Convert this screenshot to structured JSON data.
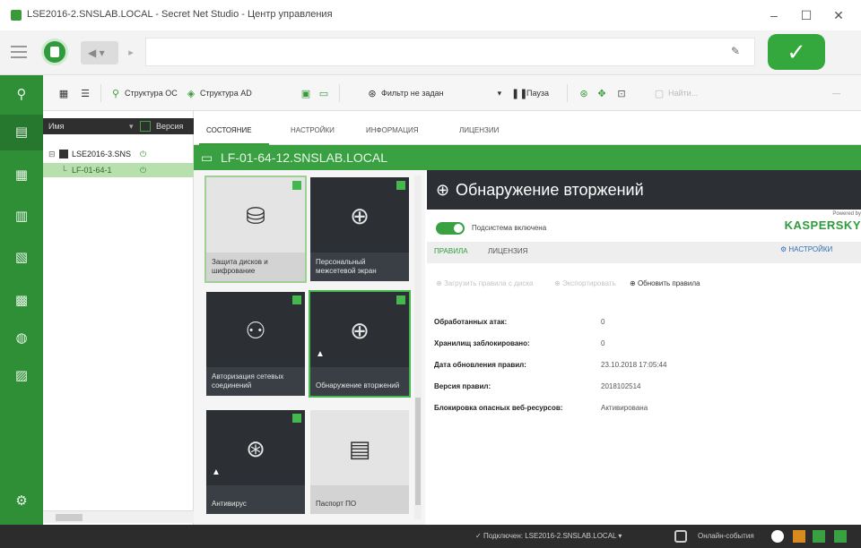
{
  "window": {
    "title": "LSE2016-2.SNSLAB.LOCAL - Secret Net Studio - Центр управления",
    "minimize_glyph": "–",
    "maximize_glyph": "☐",
    "close_glyph": "✕"
  },
  "navbar": {
    "back_glyph": "◀ ▾",
    "forward_glyph": "▸",
    "address_value": "",
    "pin_glyph": "✎",
    "ok_glyph": "✓"
  },
  "rail": {
    "icons": [
      "search-icon",
      "monitor-icon",
      "report-icon",
      "journal-icon",
      "policy-icon",
      "grid-icon",
      "shield-icon",
      "document-icon",
      "settings-icon"
    ],
    "glyphs": [
      "⚲",
      "▤",
      "▦",
      "▥",
      "▧",
      "▩",
      "◍",
      "▨",
      "⚙"
    ]
  },
  "toolbar": {
    "structure_ds": "Структура ОС",
    "structure_ad": "Структура AD",
    "filter": "Фильтр не задан",
    "pause": "Пауза",
    "search_placeholder": "Найти...",
    "view_grid_glyph": "▦",
    "view_list_glyph": "☰",
    "filter_drop": "▾"
  },
  "tree": {
    "header_name": "Имя",
    "header_status": "Версия",
    "rows": [
      "LSE2016-3.SNS",
      "LF-01-64-1"
    ]
  },
  "tabs": [
    "СОСТОЯНИЕ",
    "НАСТРОЙКИ",
    "ИНФОРМАЦИЯ",
    "ЛИЦЕНЗИИ"
  ],
  "device": {
    "name": "LF-01-64-12.SNSLAB.LOCAL"
  },
  "tiles": [
    {
      "label": "Защита дисков и шифрование",
      "style": "light",
      "glyph": "⛁",
      "warning": false,
      "corner": true
    },
    {
      "label": "Персональный межсетевой экран",
      "style": "dark",
      "glyph": "⊕",
      "warning": false,
      "corner": true
    },
    {
      "label": "Авторизация сетевых соединений",
      "style": "dark",
      "glyph": "⚇",
      "warning": false,
      "corner": true
    },
    {
      "label": "Обнаружение вторжений",
      "style": "dark",
      "glyph": "⊕",
      "warning": true,
      "corner": true
    },
    {
      "label": "Антивирус",
      "style": "dark",
      "glyph": "⊛",
      "warning": true,
      "corner": true
    },
    {
      "label": "Паспорт ПО",
      "style": "light",
      "glyph": "▤",
      "warning": false,
      "corner": false
    }
  ],
  "detail": {
    "title": "Обнаружение вторжений",
    "toggle_label": "Подсистема включена",
    "powered_by": "Powered by",
    "brand": "KASPERSKY",
    "subtabs": [
      "ПРАВИЛА",
      "ЛИЦЕНЗИЯ"
    ],
    "settings_link": "НАСТРОЙКИ",
    "actions": [
      {
        "label": "Загрузить правила с диска",
        "enabled": false
      },
      {
        "label": "Экспортировать",
        "enabled": false
      },
      {
        "label": "Обновить правила",
        "enabled": true
      }
    ],
    "properties": [
      {
        "key": "Обработанных атак:",
        "value": "0"
      },
      {
        "key": "Хранилищ заблокировано:",
        "value": "0"
      },
      {
        "key": "Дата обновления правил:",
        "value": "23.10.2018 17:05:44"
      },
      {
        "key": "Версия правил:",
        "value": "2018102514"
      },
      {
        "key": "Блокировка опасных веб-ресурсов:",
        "value": "Активирована"
      }
    ]
  },
  "statusbar": {
    "connection": "Подключен: LSE2016-2.SNSLAB.LOCAL",
    "offline_label": "Онлайн-события"
  },
  "colors": {
    "accent": "#3aa143",
    "rail": "#2e8f36",
    "tile_dark": "#2c3035",
    "header_dark": "#2c3035",
    "status_bar": "#2c2c2c"
  }
}
